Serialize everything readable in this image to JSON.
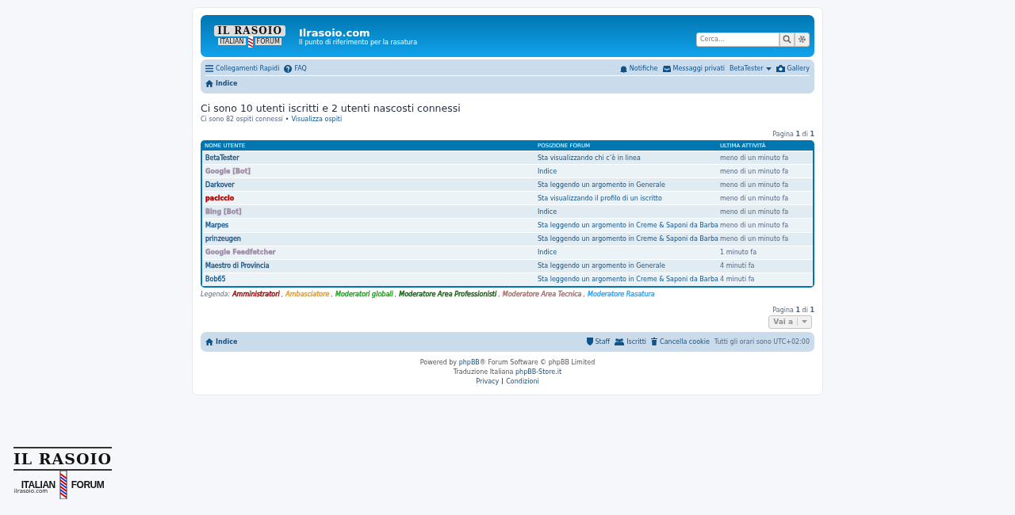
{
  "header": {
    "logo": {
      "title": "IL RASOIO",
      "left": "ITALIAN",
      "right": "FORUM"
    },
    "site_name": "Ilrasoio.com",
    "tagline": "Il punto di riferimento per la rasatura",
    "search": {
      "placeholder": "Cerca..."
    }
  },
  "navbar": {
    "left": [
      {
        "kind": "menu",
        "label": "Collegamenti Rapidi"
      },
      {
        "kind": "help",
        "label": "FAQ"
      }
    ],
    "right": [
      {
        "kind": "bell",
        "label": "Notifiche"
      },
      {
        "kind": "inbox",
        "label": "Messaggi privati"
      },
      {
        "kind": "user",
        "label": "BetaTester"
      },
      {
        "kind": "camera",
        "label": "Gallery"
      }
    ],
    "breadcrumb": "Indice"
  },
  "title": "Ci sono 10 utenti iscritti e 2 utenti nascosti connessi",
  "guests": {
    "text": "Ci sono 82 ospiti connessi",
    "separator": "•",
    "link": "Visualizza ospiti"
  },
  "pagination_top": "Pagina **1** di **1**",
  "table": {
    "columns": [
      "NOME UTENTE",
      "POSIZIONE FORUM",
      "ULTIMA ATTIVITÀ"
    ],
    "rows": [
      {
        "name": "BetaTester",
        "color": "#105289",
        "location": "Sta visualizzando chi c’è in linea",
        "time": "meno di un minuto fa"
      },
      {
        "name": "Google [Bot]",
        "color": "#9e8da7",
        "location": "Indice",
        "time": "meno di un minuto fa"
      },
      {
        "name": "Darkover",
        "color": "#105289",
        "location": "Sta leggendo un argomento in Generale",
        "time": "meno di un minuto fa"
      },
      {
        "name": "paciccio",
        "color": "#aa0000",
        "location": "Sta visualizzando il profilo di un iscritto",
        "time": "meno di un minuto fa"
      },
      {
        "name": "Bing [Bot]",
        "color": "#9e8da7",
        "location": "Indice",
        "time": "meno di un minuto fa"
      },
      {
        "name": "Marpes",
        "color": "#105289",
        "location": "Sta leggendo un argomento in Creme & Saponi da Barba",
        "time": "meno di un minuto fa"
      },
      {
        "name": "prinzeugen",
        "color": "#105289",
        "location": "Sta leggendo un argomento in Creme & Saponi da Barba",
        "time": "meno di un minuto fa"
      },
      {
        "name": "Google Feedfetcher",
        "color": "#9e8da7",
        "location": "Indice",
        "time": "1 minuto fa"
      },
      {
        "name": "Maestro di Provincia",
        "color": "#105289",
        "location": "Sta leggendo un argomento in Generale",
        "time": "4 minuti fa"
      },
      {
        "name": "Bob65",
        "color": "#105289",
        "location": "Sta leggendo un argomento in Creme & Saponi da Barba",
        "time": "4 minuti fa"
      }
    ]
  },
  "legend": {
    "label": "Legenda:",
    "separator": ",",
    "groups": [
      {
        "name": "Amministratori",
        "color": "#aa0000"
      },
      {
        "name": "Ambasciatore",
        "color": "#e0a030"
      },
      {
        "name": "Moderatori globali",
        "color": "#22aa22"
      },
      {
        "name": "Moderatore Area Professionisti",
        "color": "#116611"
      },
      {
        "name": "Moderatore Area Tecnica",
        "color": "#b07070"
      },
      {
        "name": "Moderatore Rasatura",
        "color": "#33aaff"
      }
    ]
  },
  "pagination_bottom": "Pagina **1** di **1**",
  "jump": "Vai a",
  "footer_nav": {
    "home": "Indice",
    "links": [
      {
        "kind": "shield",
        "label": "Staff"
      },
      {
        "kind": "users",
        "label": "Iscritti"
      },
      {
        "kind": "trash",
        "label": "Cancella cookie"
      }
    ],
    "timezone": "Tutti gli orari sono UTC+02:00"
  },
  "credits": {
    "powered_pre": "Powered by",
    "powered_link": "phpBB",
    "powered_post": "® Forum Software © phpBB Limited",
    "translation_pre": "Traduzione Italiana",
    "translation_link": "phpBB-Store.it",
    "links": [
      "Privacy",
      "Condizioni"
    ]
  },
  "corner_logo": {
    "title": "IL RASOIO",
    "left": "ITALIAN",
    "right": "FORUM",
    "site": "ilrasoio.com"
  }
}
